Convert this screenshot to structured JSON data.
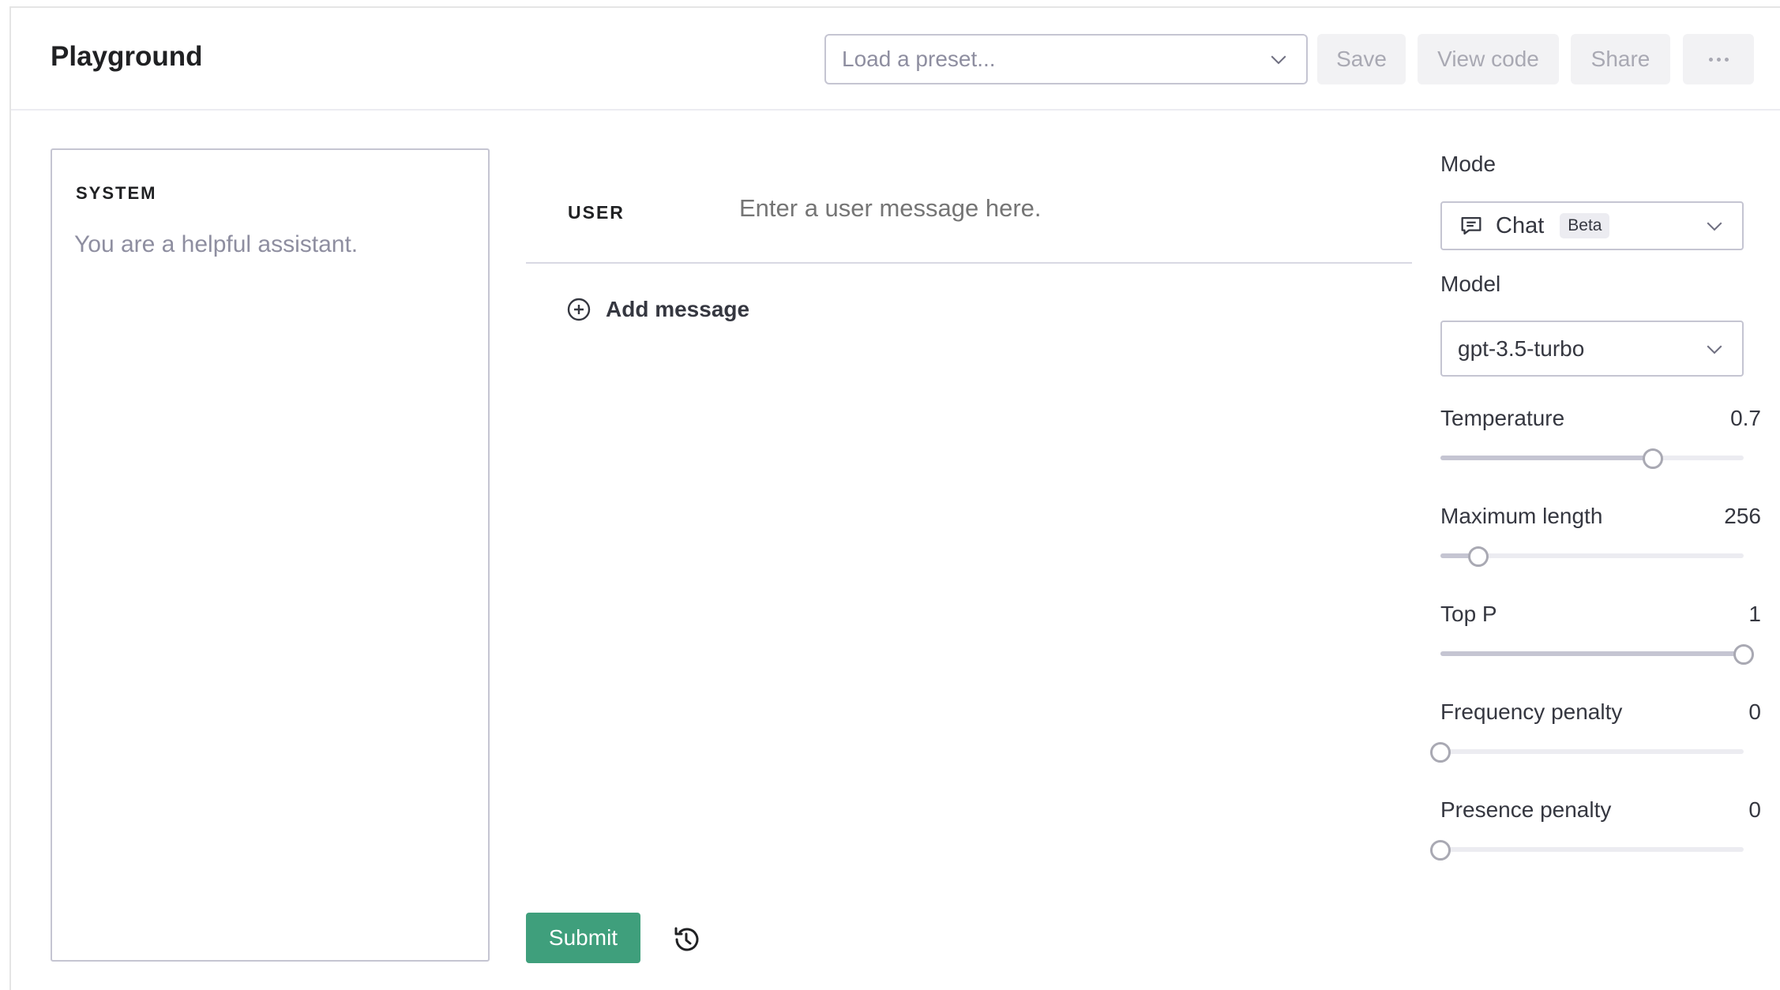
{
  "header": {
    "title": "Playground",
    "preset_placeholder": "Load a preset...",
    "save_label": "Save",
    "view_code_label": "View code",
    "share_label": "Share",
    "more_icon": "ellipsis-icon"
  },
  "system": {
    "label": "SYSTEM",
    "placeholder": "You are a helpful assistant."
  },
  "chat": {
    "user_label": "USER",
    "user_placeholder": "Enter a user message here.",
    "add_message_label": "Add message",
    "submit_label": "Submit"
  },
  "settings": {
    "mode": {
      "label": "Mode",
      "value": "Chat",
      "badge": "Beta"
    },
    "model": {
      "label": "Model",
      "value": "gpt-3.5-turbo"
    },
    "temperature": {
      "label": "Temperature",
      "value": "0.7",
      "fraction": 0.7
    },
    "max_length": {
      "label": "Maximum length",
      "value": "256",
      "fraction": 0.125
    },
    "top_p": {
      "label": "Top P",
      "value": "1",
      "fraction": 1.0
    },
    "frequency_penalty": {
      "label": "Frequency penalty",
      "value": "0",
      "fraction": 0.0
    },
    "presence_penalty": {
      "label": "Presence penalty",
      "value": "0",
      "fraction": 0.0
    }
  },
  "colors": {
    "accent": "#3f9f7c",
    "border": "#c5c5d2",
    "muted_text": "#8e8ea0"
  }
}
